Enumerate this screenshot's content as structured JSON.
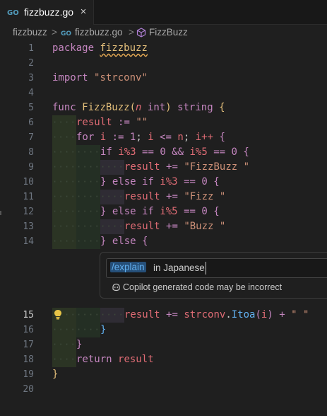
{
  "tab": {
    "label": "fizzbuzz.go",
    "close_glyph": "×",
    "icon": "go-file-icon"
  },
  "breadcrumb": {
    "folder": "fizzbuzz",
    "sep1": ">",
    "file": "fizzbuzz.go",
    "sep2": ">",
    "symbol": "FizzBuzz"
  },
  "gutter": [
    "1",
    "2",
    "3",
    "4",
    "5",
    "6",
    "7",
    "8",
    "9",
    "10",
    "11",
    "12",
    "13",
    "14",
    "15",
    "16",
    "17",
    "18",
    "19",
    "20"
  ],
  "code": {
    "l1_kw": "package",
    "l1_name": "fizzbuzz",
    "l3_kw": "import",
    "l3_str": "\"strconv\"",
    "l5_func": "func",
    "l5_name": "FizzBuzz",
    "l5_open": "(",
    "l5_param": "n",
    "l5_type": "int",
    "l5_close": ")",
    "l5_ret": "string",
    "l5_brace": "{",
    "l6_var": "result",
    "l6_op": ":=",
    "l6_str": "\"\"",
    "l7_for": "for",
    "l7_i": "i",
    "l7_op": ":=",
    "l7_num": "1",
    "l7_semi": ";",
    "l7_i2": "i",
    "l7_le": "<=",
    "l7_n": "n",
    "l7_semi2": ";",
    "l7_inc": "i++",
    "l7_brace": "{",
    "l8_if": "if",
    "l8_a": "i%3",
    "l8_eq": "==",
    "l8_z": "0",
    "l8_and": "&&",
    "l8_b": "i%5",
    "l8_eq2": "==",
    "l8_z2": "0",
    "l8_brace": "{",
    "l9_var": "result",
    "l9_op": "+=",
    "l9_str": "\"FizzBuzz \"",
    "l10_close": "}",
    "l10_else": "else",
    "l10_if": "if",
    "l10_a": "i%3",
    "l10_eq": "==",
    "l10_z": "0",
    "l10_brace": "{",
    "l11_var": "result",
    "l11_op": "+=",
    "l11_str": "\"Fizz \"",
    "l12_close": "}",
    "l12_else": "else",
    "l12_if": "if",
    "l12_a": "i%5",
    "l12_eq": "==",
    "l12_z": "0",
    "l12_brace": "{",
    "l13_var": "result",
    "l13_op": "+=",
    "l13_str": "\"Buzz \"",
    "l14_close": "}",
    "l14_else": "else",
    "l14_brace": "{",
    "l15_var": "result",
    "l15_op": "+=",
    "l15_pkg": "strconv",
    "l15_dot": ".",
    "l15_fn": "Itoa",
    "l15_open": "(",
    "l15_arg": "i",
    "l15_close": ")",
    "l15_plus": "+",
    "l15_str": "\" \"",
    "l16_close": "}",
    "l17_close": "}",
    "l18_ret": "return",
    "l18_var": "result",
    "l19_close": "}"
  },
  "inline_chat": {
    "command": "/explain",
    "rest": " in Japanese",
    "disclaimer": "Copilot generated code may be incorrect"
  },
  "colors": {
    "background": "#1f1f1f",
    "keyword": "#c586c0",
    "string": "#ce9178",
    "command_highlight": "#264f78"
  }
}
